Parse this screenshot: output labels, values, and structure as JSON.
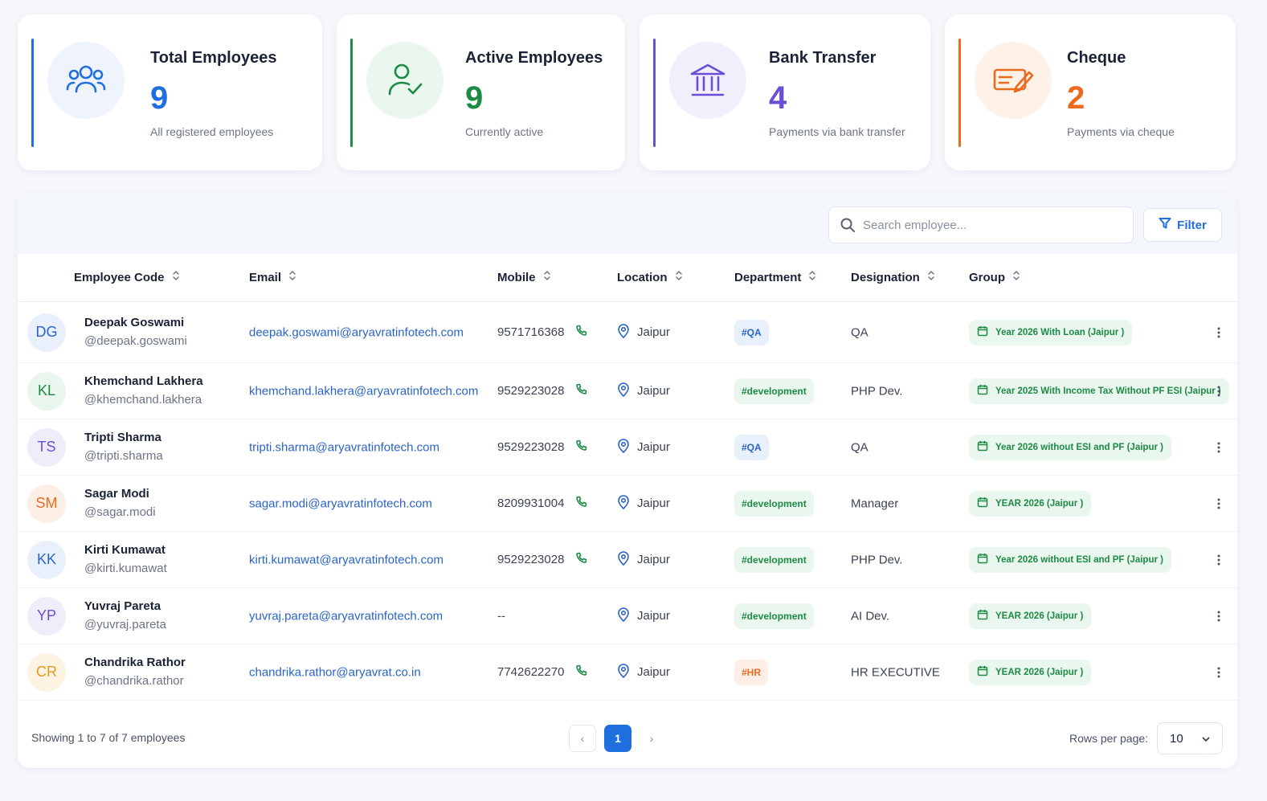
{
  "colors": {
    "blue": "#1f6fe0",
    "green": "#1d8a45",
    "purple": "#6a4fd6",
    "orange": "#ea6b1d"
  },
  "stats": [
    {
      "title": "Total Employees",
      "value": "9",
      "subtitle": "All registered employees",
      "icon": "users-icon"
    },
    {
      "title": "Active Employees",
      "value": "9",
      "subtitle": "Currently active",
      "icon": "user-check-icon"
    },
    {
      "title": "Bank Transfer",
      "value": "4",
      "subtitle": "Payments via bank transfer",
      "icon": "bank-icon"
    },
    {
      "title": "Cheque",
      "value": "2",
      "subtitle": "Payments via cheque",
      "icon": "cheque-icon"
    }
  ],
  "toolbar": {
    "search_placeholder": "Search employee...",
    "filter_label": "Filter"
  },
  "columns": [
    "Employee Code",
    "Email",
    "Mobile",
    "Location",
    "Department",
    "Designation",
    "Group"
  ],
  "employees": [
    {
      "initials": "DG",
      "name": "Deepak Goswami",
      "username": "@deepak.goswami",
      "email": "deepak.goswami@aryavratinfotech.com",
      "mobile": "9571716368",
      "location": "Jaipur",
      "department": "#QA",
      "designation": "QA",
      "group": "Year 2026 With Loan (Jaipur )"
    },
    {
      "initials": "KL",
      "name": "Khemchand Lakhera",
      "username": "@khemchand.lakhera",
      "email": "khemchand.lakhera@aryavratinfotech.com",
      "mobile": "9529223028",
      "location": "Jaipur",
      "department": "#development",
      "designation": "PHP Dev.",
      "group": "Year 2025 With Income Tax Without PF ESI (Jaipur )"
    },
    {
      "initials": "TS",
      "name": "Tripti Sharma",
      "username": "@tripti.sharma",
      "email": "tripti.sharma@aryavratinfotech.com",
      "mobile": "9529223028",
      "location": "Jaipur",
      "department": "#QA",
      "designation": "QA",
      "group": "Year 2026 without ESI and PF (Jaipur )"
    },
    {
      "initials": "SM",
      "name": "Sagar Modi",
      "username": "@sagar.modi",
      "email": "sagar.modi@aryavratinfotech.com",
      "mobile": "8209931004",
      "location": "Jaipur",
      "department": "#development",
      "designation": "Manager",
      "group": "YEAR 2026 (Jaipur )"
    },
    {
      "initials": "KK",
      "name": "Kirti Kumawat",
      "username": "@kirti.kumawat",
      "email": "kirti.kumawat@aryavratinfotech.com",
      "mobile": "9529223028",
      "location": "Jaipur",
      "department": "#development",
      "designation": "PHP Dev.",
      "group": "Year 2026 without ESI and PF (Jaipur )"
    },
    {
      "initials": "YP",
      "name": "Yuvraj Pareta",
      "username": "@yuvraj.pareta",
      "email": "yuvraj.pareta@aryavratinfotech.com",
      "mobile": "--",
      "location": "Jaipur",
      "department": "#development",
      "designation": "AI Dev.",
      "group": "YEAR 2026 (Jaipur )"
    },
    {
      "initials": "CR",
      "name": "Chandrika Rathor",
      "username": "@chandrika.rathor",
      "email": "chandrika.rathor@aryavrat.co.in",
      "mobile": "7742622270",
      "location": "Jaipur",
      "department": "#HR",
      "designation": "HR EXECUTIVE",
      "group": "YEAR 2026 (Jaipur )"
    }
  ],
  "footer": {
    "showing": "Showing 1 to 7 of 7 employees",
    "current_page": "1",
    "prev": "‹",
    "next": "›",
    "rows_label": "Rows per page:",
    "rows_value": "10"
  }
}
